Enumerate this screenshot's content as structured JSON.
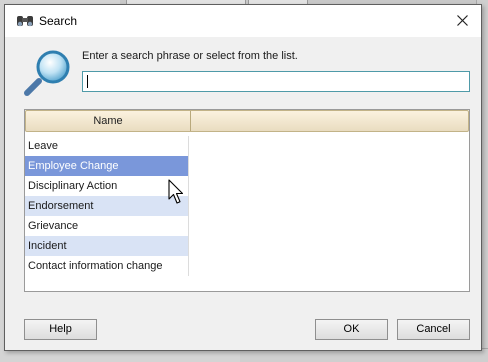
{
  "dialog": {
    "title": "Search",
    "prompt": "Enter a search phrase or select from the list.",
    "search_value": "",
    "accent_color": "#7a97da",
    "alt_row_color": "#d9e3f5"
  },
  "list": {
    "column_header": "Name",
    "items": [
      {
        "label": "Leave",
        "state": "normal"
      },
      {
        "label": "Employee Change",
        "state": "selected"
      },
      {
        "label": "Disciplinary Action",
        "state": "normal"
      },
      {
        "label": "Endorsement",
        "state": "alt"
      },
      {
        "label": "Grievance",
        "state": "normal"
      },
      {
        "label": "Incident",
        "state": "alt"
      },
      {
        "label": "Contact information change",
        "state": "normal"
      }
    ]
  },
  "buttons": {
    "help": "Help",
    "ok": "OK",
    "cancel": "Cancel"
  },
  "icons": {
    "title_icon": "binoculars-icon",
    "search_icon": "magnifier-icon",
    "close_icon": "close-icon",
    "cursor": "mouse-pointer-icon"
  }
}
